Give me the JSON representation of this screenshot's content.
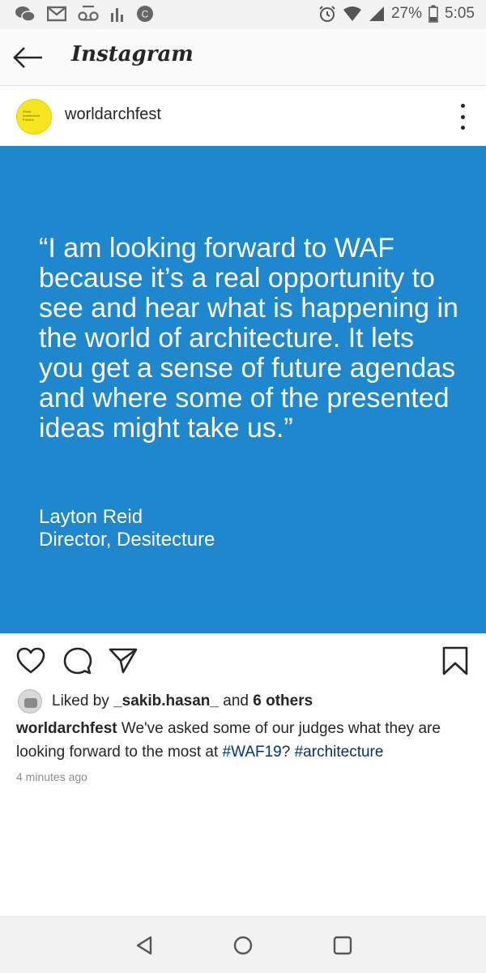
{
  "status_bar": {
    "icons": [
      "wechat-icon",
      "gmail-icon",
      "voicemail-icon",
      "signal-bars-icon",
      "app-c-icon"
    ],
    "right_icons": [
      "alarm-icon",
      "wifi-icon",
      "cell-signal-icon",
      "battery-icon"
    ],
    "battery": "27%",
    "time": "5:05"
  },
  "app_bar": {
    "title": "Instagram"
  },
  "post": {
    "username": "worldarchfest",
    "avatar_text": "World Architecture Festival",
    "quote": "“I am looking forward to WAF because it’s a real opportunity to see and hear what is happening in the world of architecture. It lets you get a sense of future agendas and where some of the presented ideas might take us.”",
    "attribution_name": "Layton Reid",
    "attribution_role": "Director, Desitecture",
    "image_color": "#1f87cd"
  },
  "likes": {
    "prefix": "Liked by",
    "user": "_sakib.hasan_",
    "middle": "and",
    "others": "6 others"
  },
  "caption": {
    "username": "worldarchfest",
    "text": "We've asked some of our judges what they are looking forward to the most at",
    "tag1": "#WAF19",
    "between": "?",
    "tag2": "#architecture"
  },
  "timestamp": "4 minutes ago",
  "colors": {
    "hashtag": "#003569",
    "accent_yellow": "#f6e51f"
  }
}
